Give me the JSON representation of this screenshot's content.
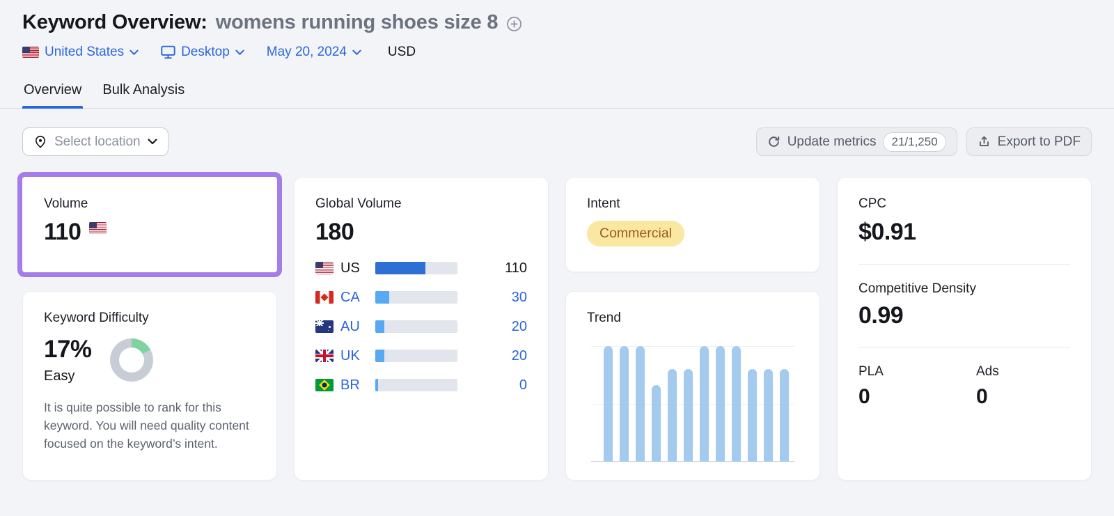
{
  "header": {
    "title": "Keyword Overview:",
    "keyword": "womens running shoes size 8",
    "filters": {
      "country": "United States",
      "device": "Desktop",
      "date": "May 20, 2024",
      "currency": "USD"
    }
  },
  "tabs": [
    {
      "label": "Overview",
      "active": true
    },
    {
      "label": "Bulk Analysis",
      "active": false
    }
  ],
  "toolbar": {
    "select_location": "Select location",
    "update_metrics": "Update metrics",
    "update_quota": "21/1,250",
    "export_pdf": "Export to PDF"
  },
  "cards": {
    "volume": {
      "title": "Volume",
      "value": "110",
      "flag": "us"
    },
    "global_volume": {
      "title": "Global Volume",
      "value": "180",
      "rows": [
        {
          "code": "US",
          "value": "110",
          "share": 0.61,
          "selected": true
        },
        {
          "code": "CA",
          "value": "30",
          "share": 0.17,
          "selected": false
        },
        {
          "code": "AU",
          "value": "20",
          "share": 0.11,
          "selected": false
        },
        {
          "code": "UK",
          "value": "20",
          "share": 0.11,
          "selected": false
        },
        {
          "code": "BR",
          "value": "0",
          "share": 0.03,
          "selected": false
        }
      ]
    },
    "intent": {
      "title": "Intent",
      "badge": "Commercial"
    },
    "keyword_difficulty": {
      "title": "Keyword Difficulty",
      "value": "17%",
      "percent": 17,
      "label": "Easy",
      "description": "It is quite possible to rank for this keyword. You will need quality content focused on the keyword’s intent."
    },
    "trend": {
      "title": "Trend"
    },
    "cpc": {
      "title": "CPC",
      "value": "$0.91"
    },
    "competitive_density": {
      "title": "Competitive Density",
      "value": "0.99"
    },
    "pla": {
      "title": "PLA",
      "value": "0"
    },
    "ads": {
      "title": "Ads",
      "value": "0"
    }
  },
  "chart_data": {
    "type": "bar",
    "title": "Trend",
    "note": "12 unlabeled monthly bars, values relative to max",
    "values_relative_to_max": [
      1,
      1,
      1,
      0.66,
      0.8,
      0.8,
      1,
      1,
      1,
      0.8,
      0.8,
      0.8
    ],
    "ylim": [
      0,
      1
    ],
    "grid": "3 horizontal lines (top, middle, baseline)"
  },
  "colors": {
    "accent_blue": "#2a65de",
    "highlight_purple": "#a57de9",
    "intent_badge_bg": "#fae7a1",
    "intent_badge_text": "#9d5a1c",
    "kd_green": "#7fd3a1",
    "donut_gray": "#c8cdd5",
    "bar_selected": "#2e6fd6",
    "bar_default": "#57a9f2",
    "bar_track": "#e2e5eb",
    "trend_bar": "#a4cbed"
  }
}
